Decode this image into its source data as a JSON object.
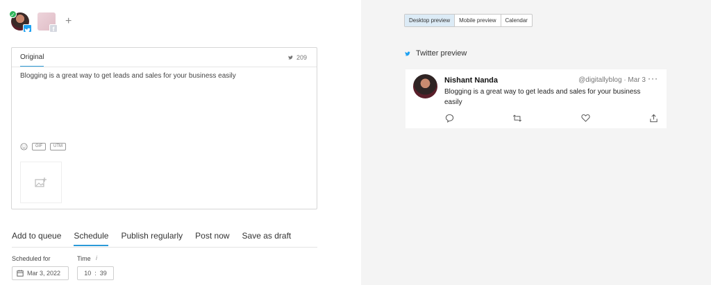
{
  "accounts": {
    "add_label": "+"
  },
  "editor": {
    "tab_label": "Original",
    "char_count": "209",
    "post_text": "Blogging is a great way to get leads and sales for your business easily",
    "gif_label": "GIF",
    "utm_label": "UTM"
  },
  "actions": {
    "items": [
      "Add to queue",
      "Schedule",
      "Publish regularly",
      "Post now",
      "Save as draft"
    ],
    "active_index": 1
  },
  "schedule": {
    "scheduled_for_label": "Scheduled for",
    "date_value": "Mar 3, 2022",
    "time_label": "Time",
    "hour": "10",
    "separator": ":",
    "minute": "39",
    "info_glyph": "i"
  },
  "preview": {
    "tabs": [
      "Desktop preview",
      "Mobile preview",
      "Calendar"
    ],
    "active_tab": 0,
    "section_title": "Twitter preview",
    "tweet": {
      "name": "Nishant Nanda",
      "handle_date": "@digitallyblog · Mar 3",
      "more": "···",
      "text": "Blogging is a great way to get leads and sales for your business easily"
    }
  },
  "colors": {
    "accent": "#2a9ad8",
    "twitter_blue": "#1da1f2",
    "active_tab_bg": "#dcebf6",
    "right_panel_bg": "#f4f4f4"
  }
}
